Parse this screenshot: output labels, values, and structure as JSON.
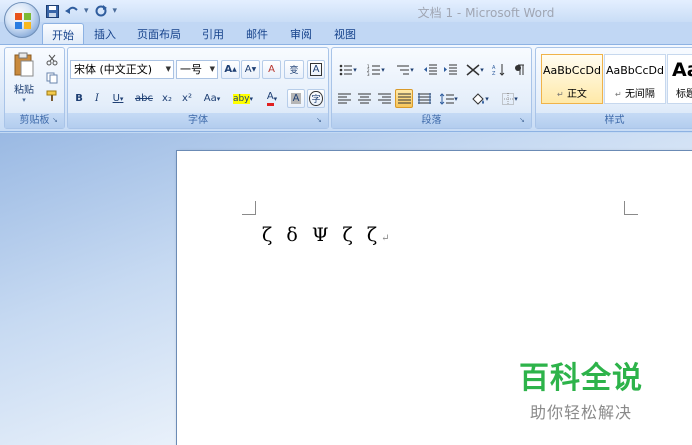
{
  "window": {
    "title": "文档 1 - Microsoft Word"
  },
  "quick_access": {
    "icons": [
      "save-icon",
      "undo-icon",
      "redo-icon"
    ],
    "customize": "▾"
  },
  "tabs": [
    {
      "label": "开始",
      "active": true
    },
    {
      "label": "插入"
    },
    {
      "label": "页面布局"
    },
    {
      "label": "引用"
    },
    {
      "label": "邮件"
    },
    {
      "label": "审阅"
    },
    {
      "label": "视图"
    }
  ],
  "clipboard": {
    "paste_label": "粘贴",
    "group_label": "剪贴板"
  },
  "font": {
    "family": "宋体 (中文正文)",
    "size": "一号",
    "group_label": "字体",
    "bold": "B",
    "italic": "I",
    "underline": "U",
    "strike": "abc",
    "subscript": "x₂",
    "superscript": "x²",
    "change_case": "Aa",
    "grow": "A",
    "shrink": "A",
    "clear": "A",
    "char_border": "A",
    "char_shade": "A",
    "highlight": "aby",
    "font_color": "A",
    "enclose": "字",
    "phonetic": "变"
  },
  "paragraph": {
    "group_label": "段落"
  },
  "styles": {
    "group_label": "样式",
    "items": [
      {
        "sample": "AaBbCcDd",
        "name": "正文",
        "selected": true
      },
      {
        "sample": "AaBbCcDd",
        "name": "无间隔"
      },
      {
        "sample": "Aa",
        "name": "标题"
      }
    ]
  },
  "document": {
    "text": "ζ δ Ψ ζ ζ",
    "para_mark": "↵"
  },
  "watermark": {
    "title": "百科全说",
    "subtitle": "助你轻松解决"
  },
  "colors": {
    "accent": "#15428b",
    "ribbon": "#dbe8f8",
    "watermark_green": "#2db34a"
  }
}
